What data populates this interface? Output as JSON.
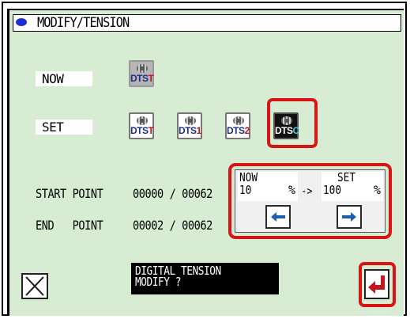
{
  "title": "MODIFY/TENSION",
  "rows": {
    "now_label": "NOW",
    "set_label": "SET"
  },
  "now_icon": {
    "prefix": "DTS",
    "suffix": "T",
    "suffix_color": "#c0181f"
  },
  "set_icons": [
    {
      "prefix": "DTS",
      "suffix": "T",
      "suffix_color": "#c0181f",
      "selected": false
    },
    {
      "prefix": "DTS",
      "suffix": "1",
      "suffix_color": "#c0181f",
      "selected": false
    },
    {
      "prefix": "DTS",
      "suffix": "2",
      "suffix_color": "#c0181f",
      "selected": false
    },
    {
      "prefix": "DTS",
      "suffix": "C",
      "suffix_color": "#2fd0e6",
      "selected": true
    }
  ],
  "points": {
    "start_label": "START POINT",
    "start_value": "00000 / 00062",
    "end_label": "END   POINT",
    "end_value": "00002 / 00062"
  },
  "adjust": {
    "now_head": "NOW",
    "now_value": "10",
    "now_unit": "%",
    "arrow": "->",
    "set_head": "SET",
    "set_value": "100",
    "set_unit": "%"
  },
  "message": {
    "line1": "DIGITAL TENSION",
    "line2": "MODIFY ?"
  },
  "colors": {
    "background": "#d7ecd2",
    "highlight": "#d81414",
    "arrow_blue": "#1a5fb4",
    "enter_red": "#c0181f"
  }
}
